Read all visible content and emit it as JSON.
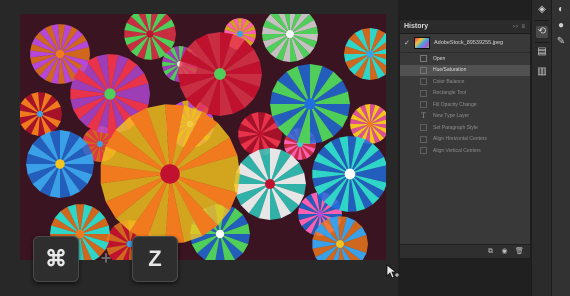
{
  "canvas": {
    "image_alt": "Colorful paper rosettes"
  },
  "keys": {
    "command": "⌘",
    "plus": "+",
    "z": "Z"
  },
  "history_panel": {
    "title": "History",
    "controls": "›› ≡",
    "snapshot_label": "AdobeStock_89539255.jpeg",
    "steps": [
      {
        "label": "Open"
      },
      {
        "label": "Hue/Saturation"
      },
      {
        "label": "Color Balance"
      },
      {
        "label": "Rectangle Tool"
      },
      {
        "label": "Fill Opacity Change"
      },
      {
        "label": "New Type Layer"
      },
      {
        "label": "Set Paragraph Style"
      },
      {
        "label": "Align Horizontal Centers"
      },
      {
        "label": "Align Vertical Centers"
      }
    ]
  },
  "icons": {
    "layers": "layers-icon",
    "history": "history-icon",
    "properties": "properties-icon"
  }
}
